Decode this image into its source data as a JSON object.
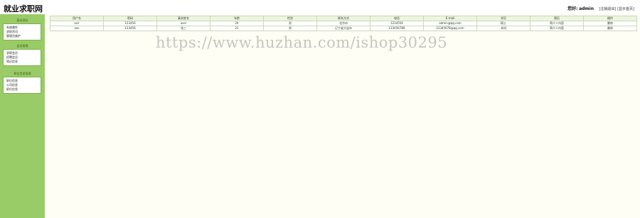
{
  "header": {
    "title": "就业求职网",
    "greeting": "您好:",
    "username": "admin",
    "links": [
      "[注销退出]",
      "[显示首页]"
    ]
  },
  "sidebar": {
    "sections": [
      {
        "title": "基本资料",
        "items": [
          "系统属性",
          "求职资讯",
          "管理员维护"
        ]
      },
      {
        "title": "会员管理",
        "items": [
          "求职会员",
          "招聘会员",
          "简历信息"
        ]
      },
      {
        "title": "职位信息管理",
        "items": [
          "职位信息",
          "公司信息",
          "职位信息"
        ]
      }
    ]
  },
  "table": {
    "headers": [
      "用户名",
      "密码",
      "真实姓名",
      "年龄",
      "性别",
      "联系方式",
      "电话",
      "E-mail",
      "学历",
      "简历",
      "操作"
    ],
    "rows": [
      [
        "asir",
        "123456",
        "user",
        "24",
        "男",
        "北京市",
        "1234556",
        "admin@qq.com",
        "硕士",
        "简介人内容",
        "删除"
      ],
      [
        "san",
        "123456",
        "张三",
        "21",
        "男",
        "辽宁省大连市",
        "123456789",
        "12345678@qq.com",
        "本科",
        "简介人内容",
        "删除"
      ]
    ]
  },
  "watermark": "https://www.huzhan.com/ishop30295"
}
